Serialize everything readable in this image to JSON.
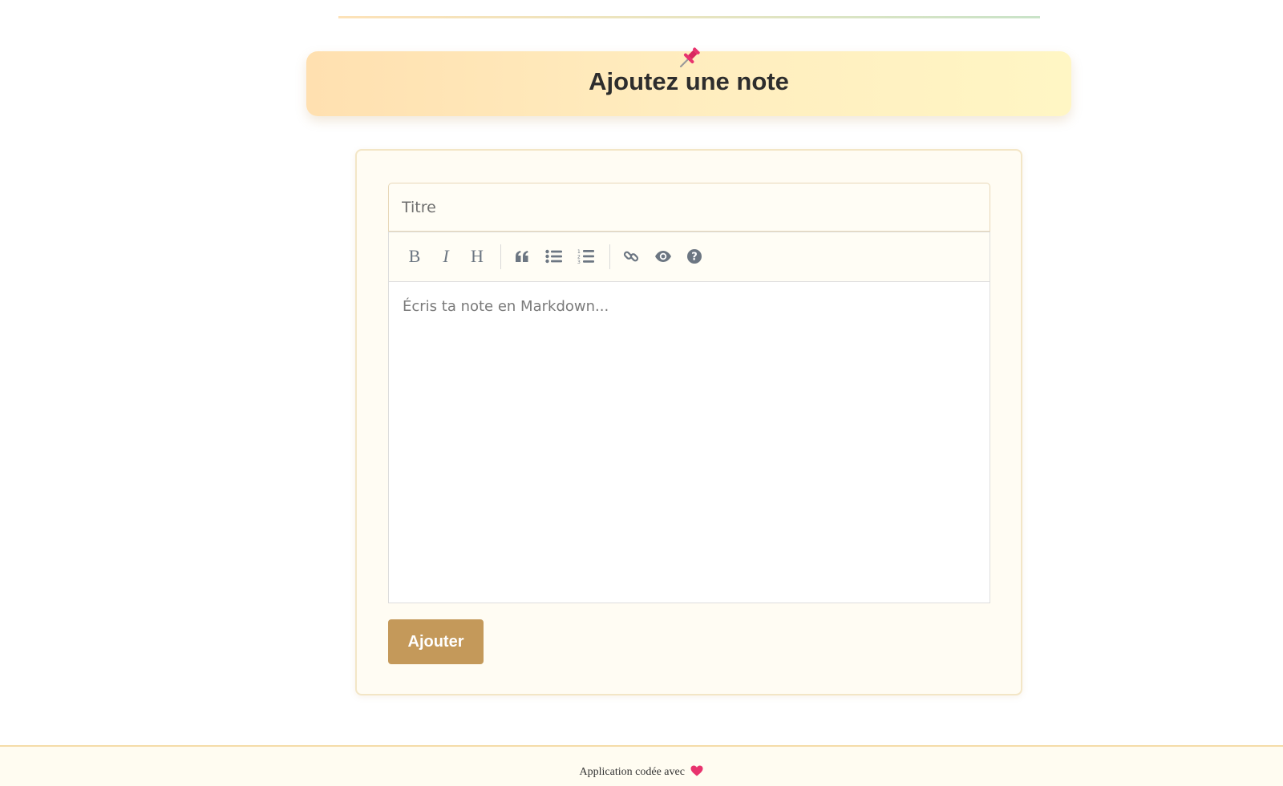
{
  "header": {
    "title": "Ajoutez une note",
    "icon": "pushpin-icon"
  },
  "form": {
    "title_placeholder": "Titre",
    "title_value": "",
    "editor_placeholder": "Écris ta note en Markdown...",
    "editor_value": "",
    "submit_label": "Ajouter"
  },
  "toolbar": {
    "items": [
      {
        "name": "bold",
        "icon": "bold-icon",
        "glyph": "B"
      },
      {
        "name": "italic",
        "icon": "italic-icon",
        "glyph": "I"
      },
      {
        "name": "heading",
        "icon": "heading-icon",
        "glyph": "H"
      },
      {
        "name": "quote",
        "icon": "quote-icon"
      },
      {
        "name": "unordered-list",
        "icon": "unordered-list-icon"
      },
      {
        "name": "ordered-list",
        "icon": "ordered-list-icon"
      },
      {
        "name": "link",
        "icon": "link-icon"
      },
      {
        "name": "preview",
        "icon": "eye-icon"
      },
      {
        "name": "guide",
        "icon": "question-icon"
      }
    ]
  },
  "footer": {
    "text": "Application codée avec",
    "icon": "heart-icon"
  },
  "colors": {
    "accent_button": "#c4995a",
    "banner_start": "#ffe0b0",
    "banner_end": "#fff6c4",
    "card_bg": "#fffcf3",
    "toolbar_icon": "#6c7682",
    "heart": "#e8336e"
  }
}
